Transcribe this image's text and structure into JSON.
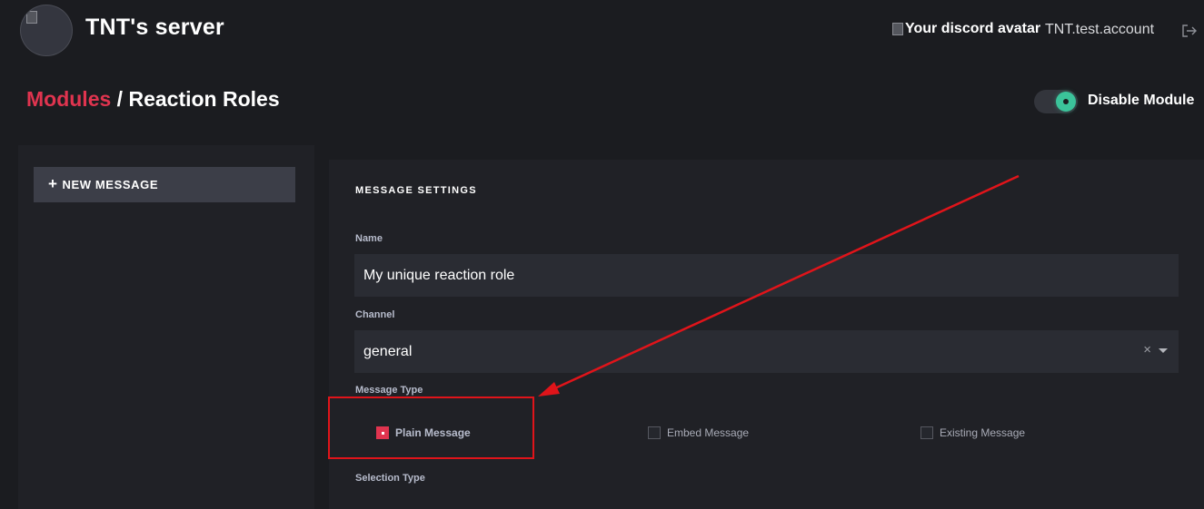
{
  "header": {
    "server_name": "TNT's server",
    "avatar_alt": "Your discord avatar",
    "username": "TNT.test.account",
    "logout_icon": "logout-icon"
  },
  "breadcrumb": {
    "parent": "Modules",
    "separator": " / ",
    "current": "Reaction Roles"
  },
  "module_toggle": {
    "label": "Disable Module",
    "enabled": true,
    "color": "#3bc39a"
  },
  "sidebar": {
    "new_message_label": "NEW MESSAGE",
    "plus_icon": "+"
  },
  "message_settings": {
    "title": "MESSAGE SETTINGS",
    "name_label": "Name",
    "name_value": "My unique reaction role",
    "channel_label": "Channel",
    "channel_value": "general",
    "clear_symbol": "×",
    "message_type_label": "Message Type",
    "message_types": [
      {
        "label": "Plain Message",
        "selected": true
      },
      {
        "label": "Embed Message",
        "selected": false
      },
      {
        "label": "Existing Message",
        "selected": false
      }
    ],
    "selection_type_label": "Selection Type"
  },
  "colors": {
    "accent": "#e0344f",
    "background": "#1b1c20",
    "panel": "#202126",
    "annotation": "#e0141a"
  }
}
